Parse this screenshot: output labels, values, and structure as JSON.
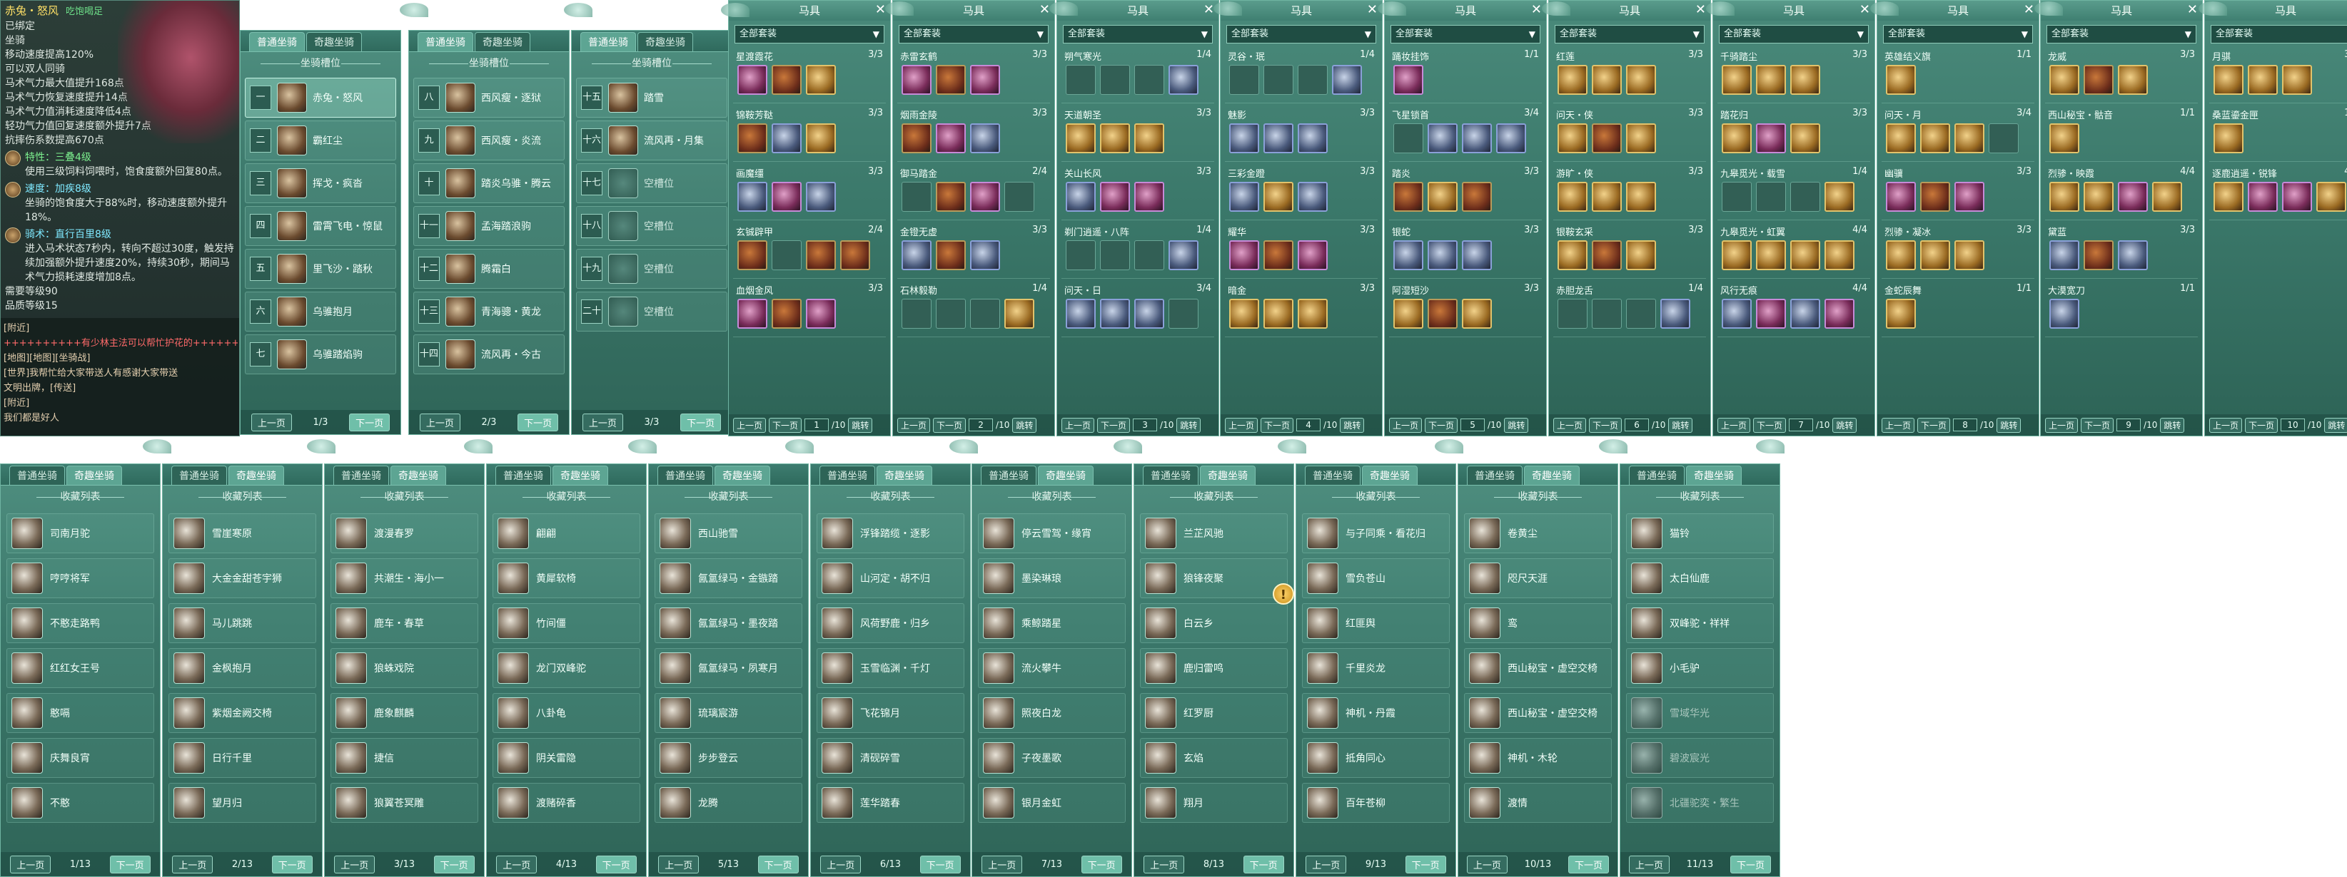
{
  "tooltip": {
    "name": "赤兔・怒风",
    "tag": "吃饱喝足",
    "lines": [
      "已绑定",
      "坐骑",
      "移动速度提高120%",
      "可以双人同骑",
      "马术气力最大值提升168点",
      "马术气力恢复速度提升14点",
      "马术气力值消耗速度降低4点",
      "轻功气力值回复速度额外提升7点",
      "抗摔伤系数提高670点"
    ],
    "skills": [
      {
        "name": "特性：三叠4级",
        "desc": "使用三级饲料饲喂时，饱食度额外回复80点。",
        "color": "green"
      },
      {
        "name": "速度：加疾8级",
        "desc": "坐骑的饱食度大于88%时，移动速度额外提升18%。",
        "color": "cyan"
      },
      {
        "name": "骑术：直行百里8级",
        "desc": "进入马术状态7秒内，转向不超过30度，触发持续加强额外提升速度20%，持续30秒，期间马术气力损耗速度增加8点。",
        "color": "cyan"
      }
    ],
    "req": [
      "需要等级90",
      "品质等级15"
    ],
    "chat": [
      "[附近]",
      "++++++++++有少林主法可以帮忙护花的++++++++++",
      "[地图][地图][坐骑战]",
      "[世界]我帮忙给大家带送人有感谢大家带送",
      "文明出牌，[传送]",
      "[附近]",
      "我们都是好人"
    ]
  },
  "slot_panels": [
    {
      "tabs": [
        "普通坐骑",
        "奇趣坐骑"
      ],
      "header": "坐骑槽位",
      "rows": [
        {
          "num": "一",
          "name": "赤兔・怒风",
          "sel": true
        },
        {
          "num": "二",
          "name": "霸红尘"
        },
        {
          "num": "三",
          "name": "挥戈・疯沓"
        },
        {
          "num": "四",
          "name": "雷霄飞电・惊鼠"
        },
        {
          "num": "五",
          "name": "里飞沙・踏秋"
        },
        {
          "num": "六",
          "name": "乌骓抱月"
        },
        {
          "num": "七",
          "name": "乌骓踏焰驹"
        }
      ],
      "prev": "上一页",
      "page": "1/3",
      "next": "下一页"
    },
    {
      "tabs": [
        "普通坐骑",
        "奇趣坐骑"
      ],
      "header": "坐骑槽位",
      "rows": [
        {
          "num": "八",
          "name": "西风瘦・逐狱"
        },
        {
          "num": "九",
          "name": "西风瘦・炎流"
        },
        {
          "num": "十",
          "name": "踏炎乌骓・腾云"
        },
        {
          "num": "十一",
          "name": "孟海踏浪驹"
        },
        {
          "num": "十二",
          "name": "腾霜白"
        },
        {
          "num": "十三",
          "name": "青海骢・黄龙"
        },
        {
          "num": "十四",
          "name": "流风再・今古"
        }
      ],
      "prev": "上一页",
      "page": "2/3",
      "next": "下一页"
    },
    {
      "tabs": [
        "普通坐骑",
        "奇趣坐骑"
      ],
      "header": "坐骑槽位",
      "rows": [
        {
          "num": "十五",
          "name": "踏雪"
        },
        {
          "num": "十六",
          "name": "流风再・月集"
        },
        {
          "num": "十七",
          "name": "空槽位",
          "empty": true
        },
        {
          "num": "十八",
          "name": "空槽位",
          "empty": true
        },
        {
          "num": "十九",
          "name": "空槽位",
          "empty": true
        },
        {
          "num": "二十",
          "name": "空槽位",
          "empty": true
        },
        {
          "num": "",
          "name": "",
          "hidden": true
        }
      ],
      "prev": "上一页",
      "page": "3/3",
      "next": "下一页"
    }
  ],
  "equip_panels": [
    {
      "title": "马具",
      "select": "全部套装",
      "sets": [
        {
          "name": "星渡霞花",
          "count": "3/3",
          "icons": [
            "purple",
            "",
            "gold"
          ]
        },
        {
          "name": "锦鞍芳鞑",
          "count": "3/3",
          "icons": [
            "",
            "blue",
            "gold"
          ]
        },
        {
          "name": "画魔缰",
          "count": "3/3",
          "icons": [
            "blue",
            "purple",
            "blue"
          ]
        },
        {
          "name": "玄铖辟甲",
          "count": "2/4",
          "icons": [
            "",
            "empty",
            "",
            ""
          ]
        },
        {
          "name": "血烟金风",
          "count": "3/3",
          "icons": [
            "purple",
            "",
            "purple"
          ]
        }
      ],
      "prev": "上一页",
      "next": "下一页",
      "page": "1",
      "total": "/10",
      "jump": "跳转"
    },
    {
      "title": "马具",
      "select": "全部套装",
      "sets": [
        {
          "name": "赤雷玄鹤",
          "count": "3/3",
          "icons": [
            "purple",
            "",
            "purple"
          ]
        },
        {
          "name": "烟雨金陵",
          "count": "3/3",
          "icons": [
            "",
            "purple",
            "blue"
          ]
        },
        {
          "name": "御马踏金",
          "count": "2/4",
          "icons": [
            "empty",
            "",
            "purple",
            "empty"
          ]
        },
        {
          "name": "金镫无虚",
          "count": "3/3",
          "icons": [
            "blue",
            "",
            "blue"
          ]
        },
        {
          "name": "石林毅勒",
          "count": "1/4",
          "icons": [
            "empty",
            "empty",
            "empty",
            "gold"
          ]
        }
      ],
      "prev": "上一页",
      "next": "下一页",
      "page": "2",
      "total": "/10",
      "jump": "跳转"
    },
    {
      "title": "马具",
      "select": "全部套装",
      "sets": [
        {
          "name": "朔气寒光",
          "count": "1/4",
          "icons": [
            "empty",
            "empty",
            "empty",
            "blue"
          ]
        },
        {
          "name": "天道朝圣",
          "count": "3/3",
          "icons": [
            "gold",
            "gold",
            "gold"
          ]
        },
        {
          "name": "关山长风",
          "count": "3/3",
          "icons": [
            "blue",
            "purple",
            "purple"
          ]
        },
        {
          "name": "剃门逍遥・八阵",
          "count": "1/4",
          "icons": [
            "empty",
            "empty",
            "empty",
            "blue"
          ]
        },
        {
          "name": "问天・日",
          "count": "3/4",
          "icons": [
            "blue",
            "blue",
            "blue",
            "empty"
          ]
        }
      ],
      "prev": "上一页",
      "next": "下一页",
      "page": "3",
      "total": "/10",
      "jump": "跳转"
    },
    {
      "title": "马具",
      "select": "全部套装",
      "sets": [
        {
          "name": "灵谷・珉",
          "count": "1/4",
          "icons": [
            "empty",
            "empty",
            "empty",
            "blue"
          ]
        },
        {
          "name": "魅影",
          "count": "3/3",
          "icons": [
            "blue",
            "blue",
            "blue"
          ]
        },
        {
          "name": "三彩金蹬",
          "count": "3/3",
          "icons": [
            "blue",
            "gold",
            "blue"
          ]
        },
        {
          "name": "耀华",
          "count": "3/3",
          "icons": [
            "purple",
            "",
            "purple"
          ]
        },
        {
          "name": "暗金",
          "count": "3/3",
          "icons": [
            "gold",
            "gold",
            "gold"
          ]
        }
      ],
      "prev": "上一页",
      "next": "下一页",
      "page": "4",
      "total": "/10",
      "jump": "跳转"
    },
    {
      "title": "马具",
      "select": "全部套装",
      "sets": [
        {
          "name": "踊妆挂饰",
          "count": "1/1",
          "icons": [
            "purple"
          ]
        },
        {
          "name": "飞星锁首",
          "count": "3/4",
          "icons": [
            "empty",
            "blue",
            "blue",
            "blue"
          ]
        },
        {
          "name": "踏炎",
          "count": "3/3",
          "icons": [
            "",
            "gold",
            ""
          ]
        },
        {
          "name": "银蛇",
          "count": "3/3",
          "icons": [
            "blue",
            "blue",
            "blue"
          ]
        },
        {
          "name": "阿湿短沙",
          "count": "3/3",
          "icons": [
            "gold",
            "",
            "gold"
          ]
        }
      ],
      "prev": "上一页",
      "next": "下一页",
      "page": "5",
      "total": "/10",
      "jump": "跳转"
    },
    {
      "title": "马具",
      "select": "全部套装",
      "sets": [
        {
          "name": "红莲",
          "count": "3/3",
          "icons": [
            "gold",
            "gold",
            "gold"
          ]
        },
        {
          "name": "问天・侠",
          "count": "3/3",
          "icons": [
            "gold",
            "",
            "gold"
          ]
        },
        {
          "name": "游旷・侠",
          "count": "3/3",
          "icons": [
            "gold",
            "gold",
            "gold"
          ]
        },
        {
          "name": "银鞍玄采",
          "count": "3/3",
          "icons": [
            "gold",
            "",
            "gold"
          ]
        },
        {
          "name": "赤胆龙舌",
          "count": "1/4",
          "icons": [
            "empty",
            "empty",
            "empty",
            "blue"
          ]
        }
      ],
      "prev": "上一页",
      "next": "下一页",
      "page": "6",
      "total": "/10",
      "jump": "跳转"
    },
    {
      "title": "马具",
      "select": "全部套装",
      "sets": [
        {
          "name": "千骑踏尘",
          "count": "3/3",
          "icons": [
            "gold",
            "gold",
            "gold"
          ]
        },
        {
          "name": "踏花归",
          "count": "3/3",
          "icons": [
            "gold",
            "purple",
            "gold"
          ]
        },
        {
          "name": "九皋觅光・载雪",
          "count": "1/4",
          "icons": [
            "empty",
            "empty",
            "empty",
            "gold"
          ]
        },
        {
          "name": "九皋觅光・虹翼",
          "count": "4/4",
          "icons": [
            "gold",
            "gold",
            "gold",
            "gold"
          ]
        },
        {
          "name": "风行无痕",
          "count": "4/4",
          "icons": [
            "blue",
            "purple",
            "blue",
            "purple"
          ]
        }
      ],
      "prev": "上一页",
      "next": "下一页",
      "page": "7",
      "total": "/10",
      "jump": "跳转"
    },
    {
      "title": "马具",
      "select": "全部套装",
      "sets": [
        {
          "name": "英雄结义旗",
          "count": "1/1",
          "icons": [
            "gold"
          ]
        },
        {
          "name": "问天・月",
          "count": "3/4",
          "icons": [
            "gold",
            "gold",
            "gold",
            "empty"
          ]
        },
        {
          "name": "幽骥",
          "count": "3/3",
          "icons": [
            "purple",
            "",
            "purple"
          ]
        },
        {
          "name": "烈骖・凝冰",
          "count": "3/3",
          "icons": [
            "gold",
            "gold",
            "gold"
          ]
        },
        {
          "name": "金蛇辰舞",
          "count": "1/1",
          "icons": [
            "gold"
          ]
        }
      ],
      "prev": "上一页",
      "next": "下一页",
      "page": "8",
      "total": "/10",
      "jump": "跳转"
    },
    {
      "title": "马具",
      "select": "全部套装",
      "sets": [
        {
          "name": "龙威",
          "count": "3/3",
          "icons": [
            "gold",
            "",
            "gold"
          ]
        },
        {
          "name": "西山秘宝・骷音",
          "count": "1/1",
          "icons": [
            "gold"
          ]
        },
        {
          "name": "烈骖・映霞",
          "count": "4/4",
          "icons": [
            "gold",
            "gold",
            "purple",
            "gold"
          ]
        },
        {
          "name": "黛蓝",
          "count": "3/3",
          "icons": [
            "blue",
            "",
            "blue"
          ]
        },
        {
          "name": "大漠宽刀",
          "count": "1/1",
          "icons": [
            "blue"
          ]
        }
      ],
      "prev": "上一页",
      "next": "下一页",
      "page": "9",
      "total": "/10",
      "jump": "跳转"
    },
    {
      "title": "马具",
      "select": "全部套装",
      "sets": [
        {
          "name": "月骐",
          "count": "3/3",
          "icons": [
            "gold",
            "gold",
            "gold"
          ]
        },
        {
          "name": "桑蓝鎏金匣",
          "count": "1/1",
          "icons": [
            "gold"
          ]
        },
        {
          "name": "逐鹿逍遥・锐锋",
          "count": "4/4",
          "icons": [
            "gold",
            "purple",
            "purple",
            "gold"
          ]
        }
      ],
      "prev": "上一页",
      "next": "下一页",
      "page": "10",
      "total": "/10",
      "jump": "跳转"
    }
  ],
  "collection_panels": [
    {
      "tabs": [
        "普通坐骑",
        "奇趣坐骑"
      ],
      "header": "收藏列表",
      "items": [
        "司南月驼",
        "哼哼将军",
        "不憨走路鸭",
        "红红女王号",
        "憨嗝",
        "庆舞良宵",
        "不憨"
      ],
      "prev": "上一页",
      "page": "1/13",
      "next": "下一页"
    },
    {
      "tabs": [
        "普通坐骑",
        "奇趣坐骑"
      ],
      "header": "收藏列表",
      "items": [
        "雪崖寒原",
        "大金金甜苍宇狮",
        "马儿跳跳",
        "金枫抱月",
        "紫烟金阙交椅",
        "日行千里",
        "望月归"
      ],
      "prev": "上一页",
      "page": "2/13",
      "next": "下一页"
    },
    {
      "tabs": [
        "普通坐骑",
        "奇趣坐骑"
      ],
      "header": "收藏列表",
      "items": [
        "渡漫春罗",
        "共潮生・海小一",
        "鹿车・春草",
        "狼蛛戏院",
        "鹿象麒麟",
        "捷信",
        "狼翼苍冥雕"
      ],
      "prev": "上一页",
      "page": "3/13",
      "next": "下一页"
    },
    {
      "tabs": [
        "普通坐骑",
        "奇趣坐骑"
      ],
      "header": "收藏列表",
      "items": [
        "翩翩",
        "黄犀软椅",
        "竹间僵",
        "龙门双峰驼",
        "八卦龟",
        "阴关雷隐",
        "渡赌碎香"
      ],
      "prev": "上一页",
      "page": "4/13",
      "next": "下一页"
    },
    {
      "tabs": [
        "普通坐骑",
        "奇趣坐骑"
      ],
      "header": "收藏列表",
      "items": [
        "西山驰雪",
        "氤氲绿马・金镞踏",
        "氤氲绿马・墨夜踏",
        "氤氲绿马・夙寒月",
        "琉璃宸游",
        "步步登云",
        "龙腾"
      ],
      "prev": "上一页",
      "page": "5/13",
      "next": "下一页"
    },
    {
      "tabs": [
        "普通坐骑",
        "奇趣坐骑"
      ],
      "header": "收藏列表",
      "items": [
        "浮锋踏缆・逐影",
        "山河定・胡不归",
        "风荷野鹿・归乡",
        "玉雪临渊・千灯",
        "飞花锦月",
        "清砚碎雪",
        "莲华踏春"
      ],
      "prev": "上一页",
      "page": "6/13",
      "next": "下一页"
    },
    {
      "tabs": [
        "普通坐骑",
        "奇趣坐骑"
      ],
      "header": "收藏列表",
      "items": [
        "停云雪驾・缘宵",
        "墨染琳琅",
        "乘鲸踏星",
        "流火攀牛",
        "照夜白龙",
        "子夜墨歌",
        "银月金虹"
      ],
      "prev": "上一页",
      "page": "7/13",
      "next": "下一页"
    },
    {
      "tabs": [
        "普通坐骑",
        "奇趣坐骑"
      ],
      "header": "收藏列表",
      "items": [
        "兰芷风驰",
        "狼锋夜聚",
        "白云乡",
        "鹿归雷鸣",
        "红罗厨",
        "玄焰",
        "翔月"
      ],
      "prev": "上一页",
      "page": "8/13",
      "next": "下一页"
    },
    {
      "tabs": [
        "普通坐骑",
        "奇趣坐骑"
      ],
      "header": "收藏列表",
      "items": [
        "与子同乘・看花归",
        "雪负苍山",
        "红匪舆",
        "千里炎龙",
        "神机・丹霞",
        "抵角同心",
        "百年苍柳"
      ],
      "prev": "上一页",
      "page": "9/13",
      "next": "下一页"
    },
    {
      "tabs": [
        "普通坐骑",
        "奇趣坐骑"
      ],
      "header": "收藏列表",
      "items": [
        "卷黄尘",
        "咫尺天涯",
        "鸾",
        "西山秘宝・虚空交椅",
        "西山秘宝・虚空交椅",
        "神机・木轮",
        "渡情"
      ],
      "prev": "上一页",
      "page": "10/13",
      "next": "下一页"
    },
    {
      "tabs": [
        "普通坐骑",
        "奇趣坐骑"
      ],
      "header": "收藏列表",
      "items": [
        "猫铃",
        "太白仙鹿",
        "双峰驼・祥祥",
        "小毛驴",
        "雪域华光",
        "碧波宸光",
        "北疆驼奕・繁生"
      ],
      "gray_from": 4,
      "prev": "上一页",
      "page": "11/13",
      "next": "下一页"
    }
  ]
}
